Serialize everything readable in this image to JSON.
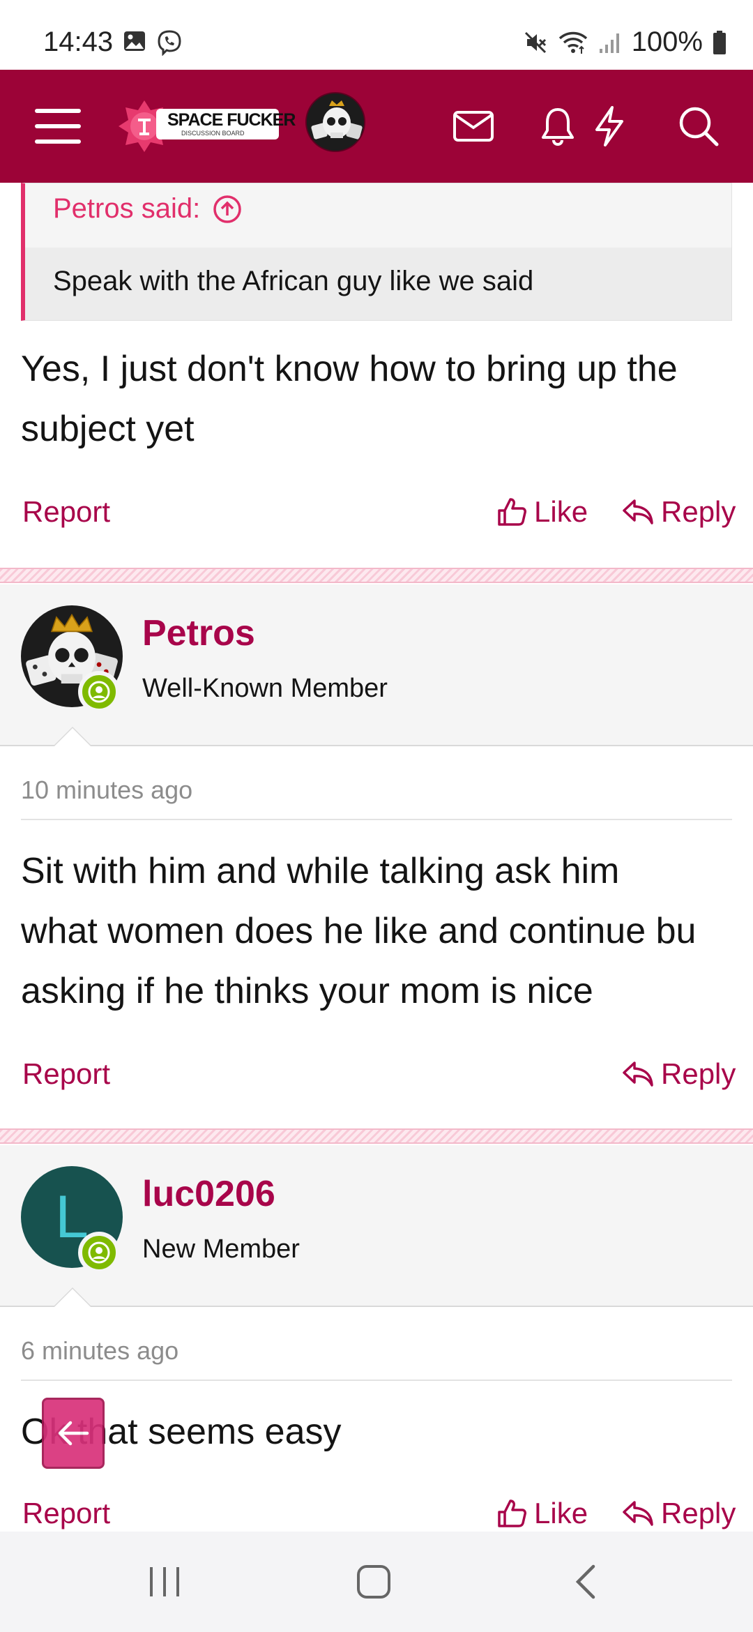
{
  "status_bar": {
    "time": "14:43",
    "battery": "100%",
    "icons": [
      "gallery-icon",
      "viber-icon",
      "mute-icon",
      "wifi-icon",
      "signal-icon",
      "battery-icon"
    ]
  },
  "header": {
    "logo_title": "SPACE FUCKER",
    "logo_subtitle": "DISCUSSION BOARD",
    "icons": [
      "menu-icon",
      "inbox-icon",
      "bell-icon",
      "lightning-icon",
      "search-icon"
    ],
    "color": "#9c0337"
  },
  "quote": {
    "author": "Petros said:",
    "text": "Speak with the African guy like we said"
  },
  "posts": [
    {
      "text_line1": "Yes, I just don't know how to bring up the",
      "text_line2": "subject yet",
      "report": "Report",
      "like": "Like",
      "reply": "Reply"
    },
    {
      "username": "Petros",
      "user_title": "Well-Known Member",
      "date": "10 minutes ago",
      "text_line1": "Sit with him and while talking ask him",
      "text_line2": "what women does he like and continue bu",
      "text_line3": "asking if he thinks your mom is nice",
      "report": "Report",
      "reply": "Reply"
    },
    {
      "username": "luc0206",
      "avatar_letter": "L",
      "user_title": "New Member",
      "date": "6 minutes ago",
      "text_line1": "Ok that seems easy",
      "report": "Report",
      "like": "Like",
      "reply": "Reply"
    }
  ],
  "colors": {
    "accent": "#a8054a",
    "quote_border": "#e12f6b",
    "online": "#7fba00",
    "avatar_bg": "#17524f"
  }
}
